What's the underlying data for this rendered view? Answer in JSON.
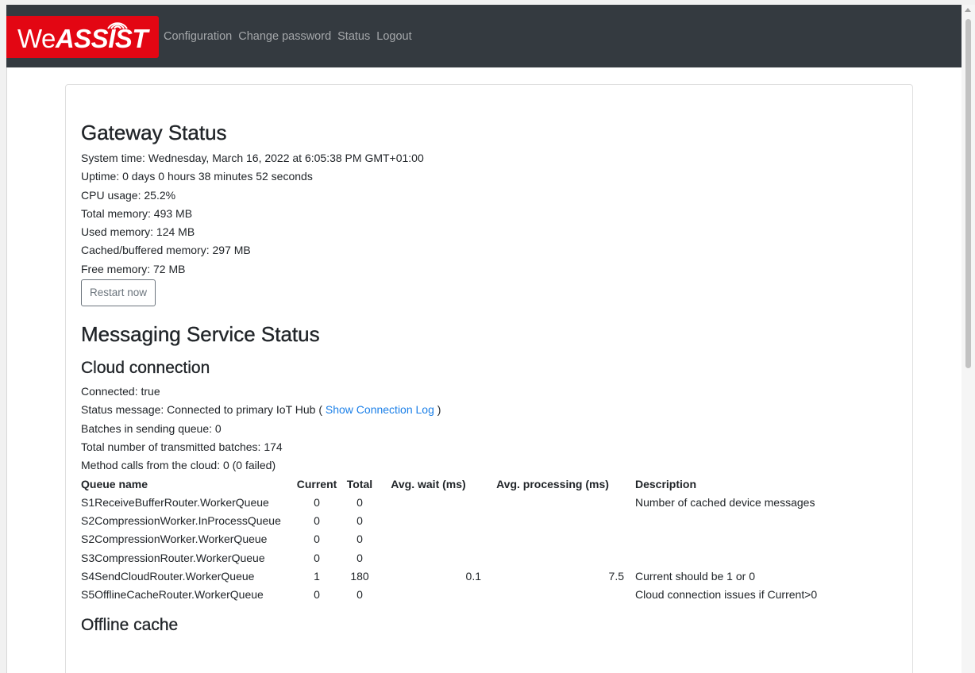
{
  "brand": {
    "prefix": "We",
    "name": "ASSIST",
    "color": "#e30613"
  },
  "nav": {
    "items": [
      "Configuration",
      "Change password",
      "Status",
      "Logout"
    ]
  },
  "gateway": {
    "title": "Gateway Status",
    "lines": [
      "System time: Wednesday, March 16, 2022 at 6:05:38 PM GMT+01:00",
      "Uptime: 0 days 0 hours 38 minutes 52 seconds",
      "CPU usage: 25.2%",
      "Total memory: 493 MB",
      "Used memory: 124 MB",
      "Cached/buffered memory: 297 MB",
      "Free memory: 72 MB"
    ],
    "restart_label": "Restart now"
  },
  "messaging": {
    "title": "Messaging Service Status",
    "cloud": {
      "title": "Cloud connection",
      "connected": "Connected: true",
      "status_prefix": "Status message: Connected to primary IoT Hub ( ",
      "status_link": "Show Connection Log",
      "status_suffix": " )",
      "batches_queue": "Batches in sending queue: 0",
      "transmitted": "Total number of transmitted batches: 174",
      "method_calls": "Method calls from the cloud: 0 (0 failed)"
    },
    "queue_table": {
      "headers": [
        "Queue name",
        "Current",
        "Total",
        "Avg. wait (ms)",
        "Avg. processing (ms)",
        "Description"
      ],
      "rows": [
        [
          "S1ReceiveBufferRouter.WorkerQueue",
          "0",
          "0",
          "",
          "",
          "Number of cached device messages"
        ],
        [
          "S2CompressionWorker.InProcessQueue",
          "0",
          "0",
          "",
          "",
          ""
        ],
        [
          "S2CompressionWorker.WorkerQueue",
          "0",
          "0",
          "",
          "",
          ""
        ],
        [
          "S3CompressionRouter.WorkerQueue",
          "0",
          "0",
          "",
          "",
          ""
        ],
        [
          "S4SendCloudRouter.WorkerQueue",
          "1",
          "180",
          "0.1",
          "7.5",
          "Current should be 1 or 0"
        ],
        [
          "S5OfflineCacheRouter.WorkerQueue",
          "0",
          "0",
          "",
          "",
          "Cloud connection issues if Current>0"
        ]
      ]
    },
    "offline_title": "Offline cache"
  }
}
